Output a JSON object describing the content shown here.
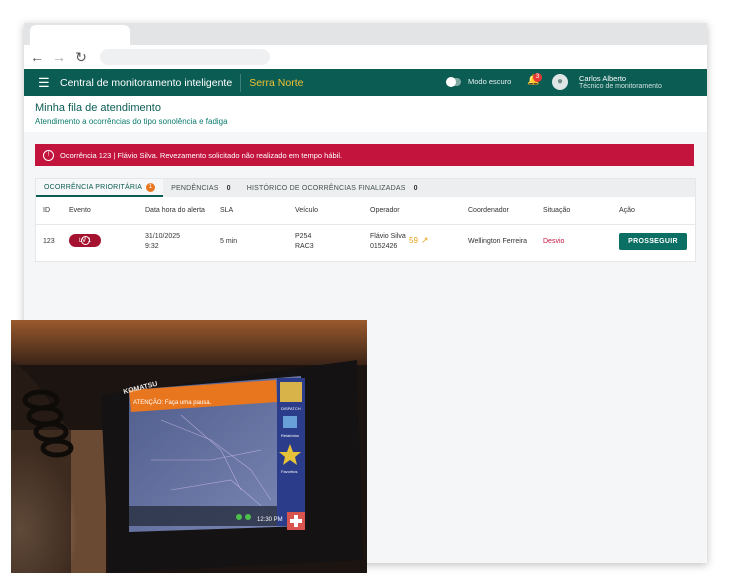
{
  "app": {
    "title": "Central de monitoramento inteligente",
    "region": "Serra Norte",
    "dark_mode_label": "Modo escuro",
    "notification_count": "3",
    "user_name": "Carlos Alberto",
    "user_role": "Técnico de monitoramento"
  },
  "page": {
    "title": "Minha fila de atendimento",
    "subtitle": "Atendimento a ocorrências do tipo sonolência e fadiga"
  },
  "alert": {
    "text": "Ocorrência 123 | Flávio Silva. Revezamento solicitado não realizado em tempo hábil."
  },
  "tabs": [
    {
      "label": "OCORRÊNCIA PRIORITÁRIA",
      "count": "1"
    },
    {
      "label": "PENDÊNCIAS",
      "count": "0"
    },
    {
      "label": "HISTÓRICO DE OCORRÊNCIAS FINALIZADAS",
      "count": "0"
    }
  ],
  "table": {
    "headers": [
      "ID",
      "Evento",
      "Data hora do alerta",
      "SLA",
      "Veículo",
      "Operador",
      "Coordenador",
      "Situação",
      "Ação"
    ],
    "row": {
      "id": "123",
      "event_level": "LV 1",
      "date": "31/10/2025",
      "time": "9:32",
      "sla": "5 min",
      "vehicle_1": "P254",
      "vehicle_2": "RAC3",
      "operator_name": "Flávio Silva",
      "operator_id": "0152426",
      "score": "59",
      "coordinator": "Wellington Ferreira",
      "status": "Desvio",
      "action_label": "PROSSEGUIR"
    }
  },
  "photo": {
    "brand": "KOMATSU",
    "banner": "ATENÇÃO: Faça uma pausa.",
    "side_buttons": [
      "DISPATCH",
      "Relatórios",
      "Favoritos"
    ],
    "clock": "12:30 PM"
  },
  "colors": {
    "primary": "#0b5c53",
    "accent": "#f1c232",
    "alert": "#c2143d",
    "badge": "#e87722"
  }
}
